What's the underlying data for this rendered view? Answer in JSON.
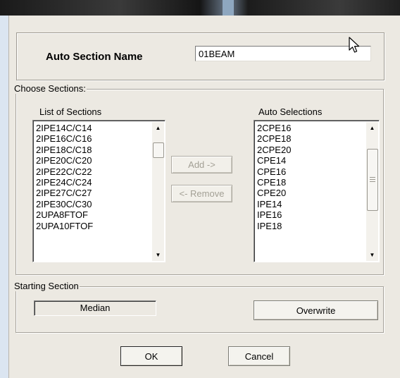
{
  "name_row": {
    "label": "Auto Section Name",
    "value": "01BEAM"
  },
  "choose_sections": {
    "title": "Choose Sections:",
    "list_of_sections": {
      "caption": "List of Sections",
      "items": [
        "2IPE14C/C14",
        "2IPE16C/C16",
        "2IPE18C/C18",
        "2IPE20C/C20",
        "2IPE22C/C22",
        "2IPE24C/C24",
        "2IPE27C/C27",
        "2IPE30C/C30",
        "2UPA8FTOF",
        "2UPA10FTOF"
      ]
    },
    "add_label": "Add ->",
    "remove_label": "<- Remove",
    "auto_selections": {
      "caption": "Auto Selections",
      "items": [
        "2CPE16",
        "2CPE18",
        "2CPE20",
        "CPE14",
        "CPE16",
        "CPE18",
        "CPE20",
        "IPE14",
        "IPE16",
        "IPE18"
      ]
    }
  },
  "starting_section": {
    "title": "Starting Section",
    "value": "Median",
    "overwrite_label": "Overwrite"
  },
  "footer": {
    "ok_label": "OK",
    "cancel_label": "Cancel"
  },
  "icons": {
    "scroll_up": "▲",
    "scroll_down": "▼"
  },
  "colors": {
    "dialog_bg": "#ece9e2",
    "titlebar": "#1a1a1a"
  }
}
